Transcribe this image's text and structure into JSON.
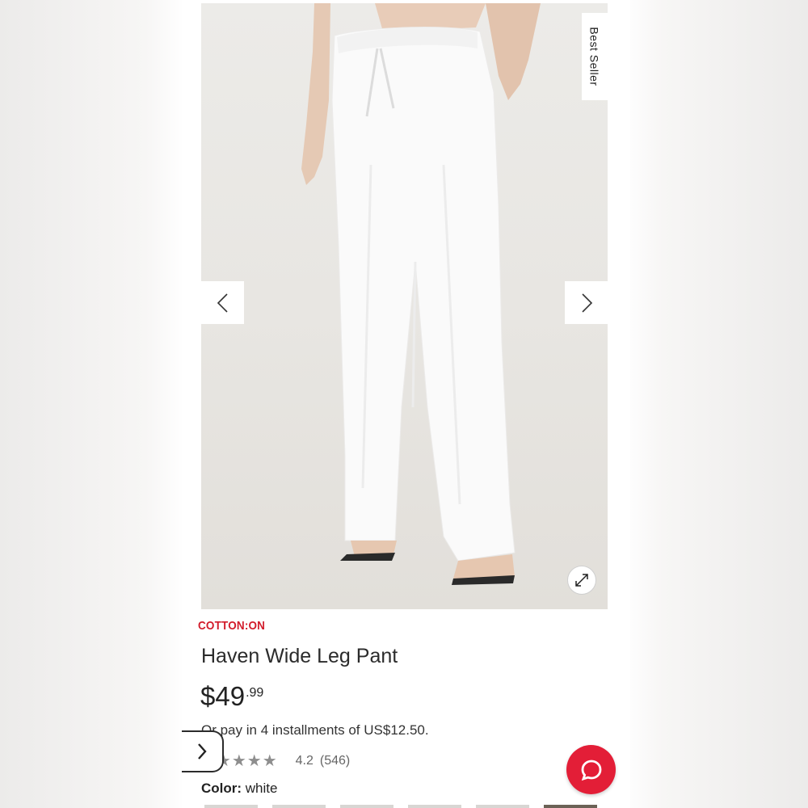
{
  "product": {
    "badge": "Best Seller",
    "brand": "COTTON:ON",
    "title": "Haven Wide Leg Pant",
    "price_main": "$49",
    "price_cents": ".99",
    "installments": "Or pay in 4 installments of US$12.50.",
    "rating": {
      "stars_text": "★★★★★",
      "value": "4.2",
      "count": "(546)"
    },
    "color_label": "Color:",
    "color_value": "white"
  },
  "icons": {
    "prev": "chevron-left-icon",
    "next": "chevron-right-icon",
    "expand": "expand-icon",
    "side_toggle": "chevron-right-icon",
    "chat": "chat-bubble-icon"
  },
  "colors": {
    "brand_red": "#d21c2b",
    "chat_red": "#e31e37",
    "hero_bg": "#e8e6e2"
  }
}
